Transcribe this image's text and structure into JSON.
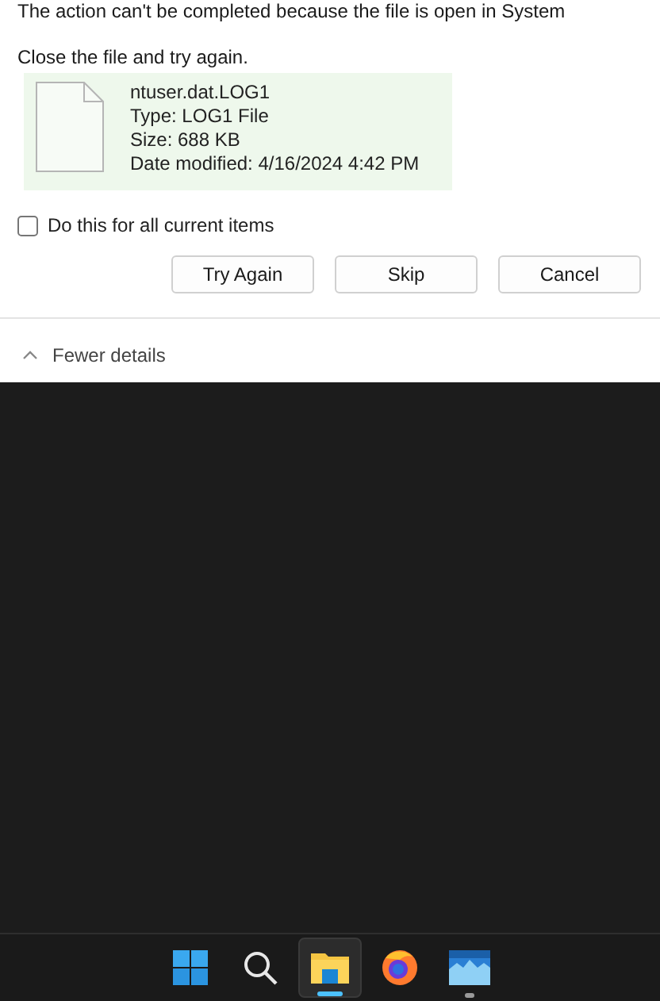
{
  "dialog": {
    "message": "The action can't be completed because the file is open in System",
    "instruction": "Close the file and try again.",
    "file": {
      "name": "ntuser.dat.LOG1",
      "type": "Type: LOG1 File",
      "size": "Size: 688 KB",
      "modified": "Date modified: 4/16/2024 4:42 PM"
    },
    "apply_all": {
      "label": "Do this for all current items",
      "checked": false
    },
    "buttons": [
      "Try Again",
      "Skip",
      "Cancel"
    ],
    "details_toggle": {
      "label": "Fewer details",
      "expanded": true
    }
  },
  "taskbar": {
    "apps": [
      {
        "kind": "start",
        "selected": false,
        "running": false
      },
      {
        "kind": "search",
        "selected": false,
        "running": false
      },
      {
        "kind": "explorer",
        "selected": true,
        "running": true
      },
      {
        "kind": "browser",
        "selected": false,
        "running": false
      },
      {
        "kind": "photos",
        "selected": false,
        "running": true
      }
    ]
  }
}
